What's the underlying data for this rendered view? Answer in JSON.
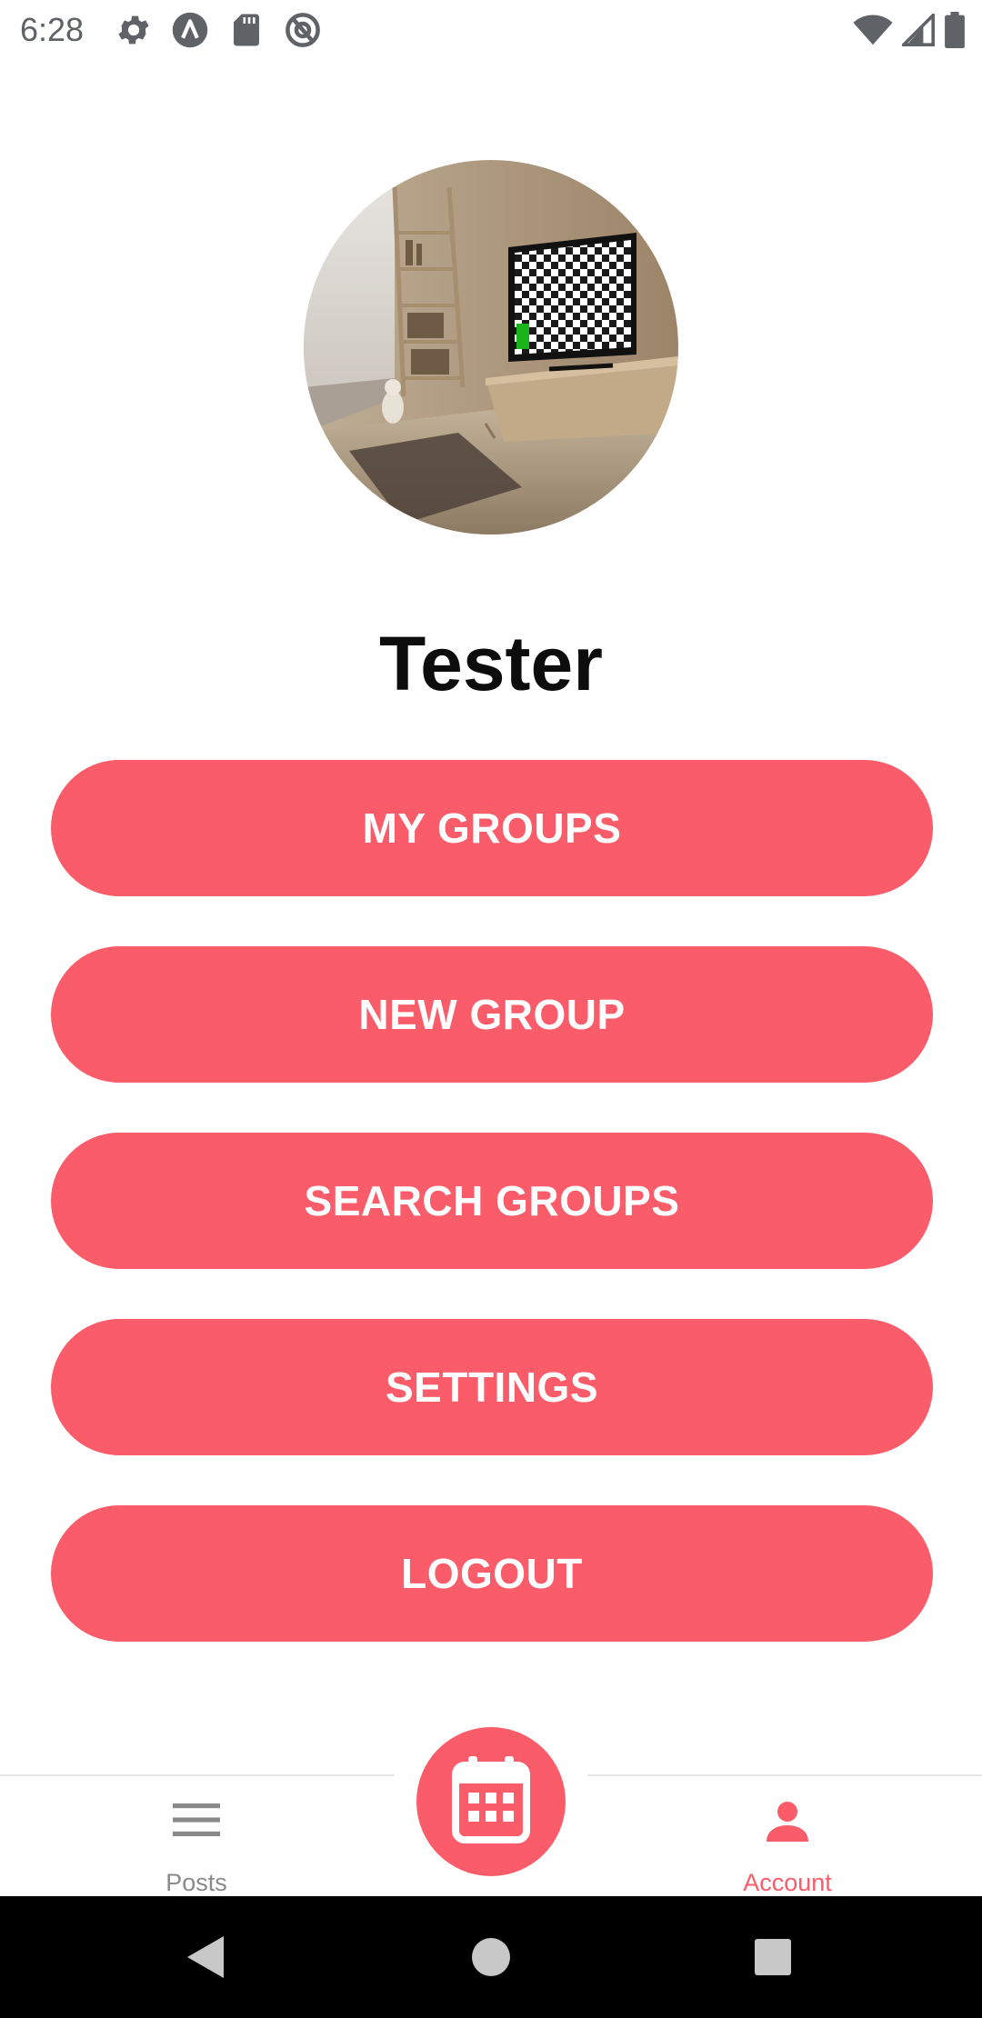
{
  "status_bar": {
    "time": "6:28",
    "left_icons": [
      "settings-icon",
      "a-circle-icon",
      "sd-card-icon",
      "at-sign-icon"
    ],
    "right_icons": [
      "wifi-icon",
      "cell-signal-icon",
      "battery-icon"
    ]
  },
  "profile": {
    "name": "Tester",
    "avatar": "room-photo"
  },
  "menu": {
    "buttons": [
      {
        "label": "MY GROUPS"
      },
      {
        "label": "NEW GROUP"
      },
      {
        "label": "SEARCH GROUPS"
      },
      {
        "label": "SETTINGS"
      },
      {
        "label": "LOGOUT"
      }
    ]
  },
  "bottom_nav": {
    "items": [
      {
        "label": "Posts",
        "icon": "menu-lines-icon",
        "active": false
      },
      {
        "label": "Account",
        "icon": "person-icon",
        "active": true
      }
    ],
    "fab_icon": "calendar-icon"
  },
  "colors": {
    "accent": "#fa5c69",
    "inactive": "#8a8a8a",
    "status_text": "#5f6368"
  }
}
